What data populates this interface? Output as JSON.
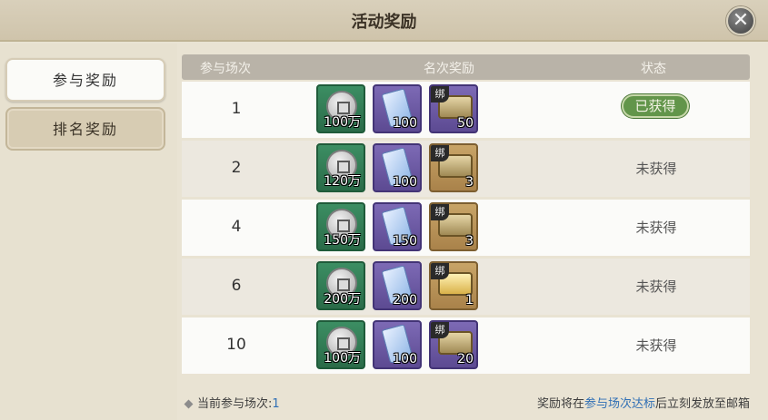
{
  "window": {
    "title": "活动奖励",
    "close_icon": "close-icon"
  },
  "tabs": [
    {
      "label": "参与奖励",
      "active": true
    },
    {
      "label": "排名奖励",
      "active": false
    }
  ],
  "table": {
    "headers": [
      "参与场次",
      "名次奖励",
      "状态"
    ],
    "rows": [
      {
        "count": "1",
        "rewards": [
          {
            "icon": "silver-coin-icon",
            "frame": "green",
            "qty": "100万",
            "bound": false
          },
          {
            "icon": "scroll-icon",
            "frame": "purple",
            "qty": "100",
            "bound": false
          },
          {
            "icon": "treasure-chest-icon",
            "frame": "purple",
            "qty": "50",
            "bound": true,
            "bind_label": "绑"
          }
        ],
        "status": "已获得",
        "obtained": true
      },
      {
        "count": "2",
        "rewards": [
          {
            "icon": "silver-coin-icon",
            "frame": "green",
            "qty": "120万",
            "bound": false
          },
          {
            "icon": "scroll-icon",
            "frame": "purple",
            "qty": "100",
            "bound": false
          },
          {
            "icon": "treasure-chest-icon",
            "frame": "gold",
            "qty": "3",
            "bound": true,
            "bind_label": "绑"
          }
        ],
        "status": "未获得",
        "obtained": false
      },
      {
        "count": "4",
        "rewards": [
          {
            "icon": "silver-coin-icon",
            "frame": "green",
            "qty": "150万",
            "bound": false
          },
          {
            "icon": "scroll-icon",
            "frame": "purple",
            "qty": "150",
            "bound": false
          },
          {
            "icon": "treasure-chest-icon",
            "frame": "gold",
            "qty": "3",
            "bound": true,
            "bind_label": "绑"
          }
        ],
        "status": "未获得",
        "obtained": false
      },
      {
        "count": "6",
        "rewards": [
          {
            "icon": "silver-coin-icon",
            "frame": "green",
            "qty": "200万",
            "bound": false
          },
          {
            "icon": "scroll-icon",
            "frame": "purple",
            "qty": "200",
            "bound": false
          },
          {
            "icon": "gold-chest-icon",
            "frame": "gold",
            "qty": "1",
            "bound": true,
            "bind_label": "绑"
          }
        ],
        "status": "未获得",
        "obtained": false
      },
      {
        "count": "10",
        "rewards": [
          {
            "icon": "silver-coin-icon",
            "frame": "green",
            "qty": "100万",
            "bound": false
          },
          {
            "icon": "scroll-icon",
            "frame": "purple",
            "qty": "100",
            "bound": false
          },
          {
            "icon": "treasure-chest-icon",
            "frame": "purple",
            "qty": "20",
            "bound": true,
            "bind_label": "绑"
          }
        ],
        "status": "未获得",
        "obtained": false
      }
    ]
  },
  "footer": {
    "current_label": "当前参与场次:",
    "current_value": "1",
    "note_prefix": "奖励将在",
    "note_highlight": "参与场次达标",
    "note_suffix": "后立刻发放至邮箱"
  }
}
